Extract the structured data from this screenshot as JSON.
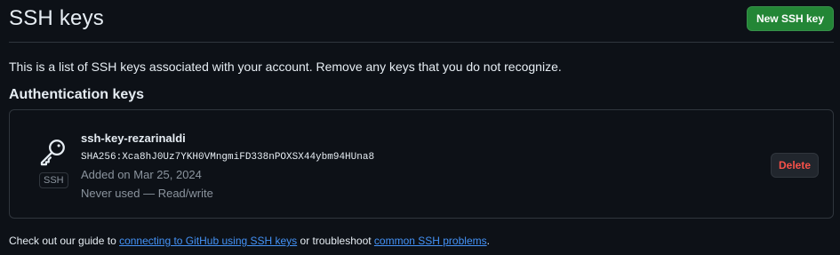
{
  "header": {
    "title": "SSH keys",
    "new_key_label": "New SSH key"
  },
  "intro": "This is a list of SSH keys associated with your account. Remove any keys that you do not recognize.",
  "section_title": "Authentication keys",
  "keys": [
    {
      "icon": "key-icon",
      "type_label": "SSH",
      "name": "ssh-key-rezarinaldi",
      "fingerprint": "SHA256:Xca8hJ0Uz7YKH0VMngmiFD338nPOXSX44ybm94HUna8",
      "added": "Added on Mar 25, 2024",
      "usage": "Never used — Read/write",
      "delete_label": "Delete"
    }
  ],
  "footer": {
    "prefix": "Check out our guide to ",
    "link1": "connecting to GitHub using SSH keys",
    "middle": " or troubleshoot ",
    "link2": "common SSH problems",
    "suffix": "."
  },
  "colors": {
    "background": "#0d1117",
    "border": "#30363d",
    "primary_button": "#238636",
    "danger_text": "#f85149",
    "link": "#4493f8",
    "muted_text": "#8b949e"
  }
}
